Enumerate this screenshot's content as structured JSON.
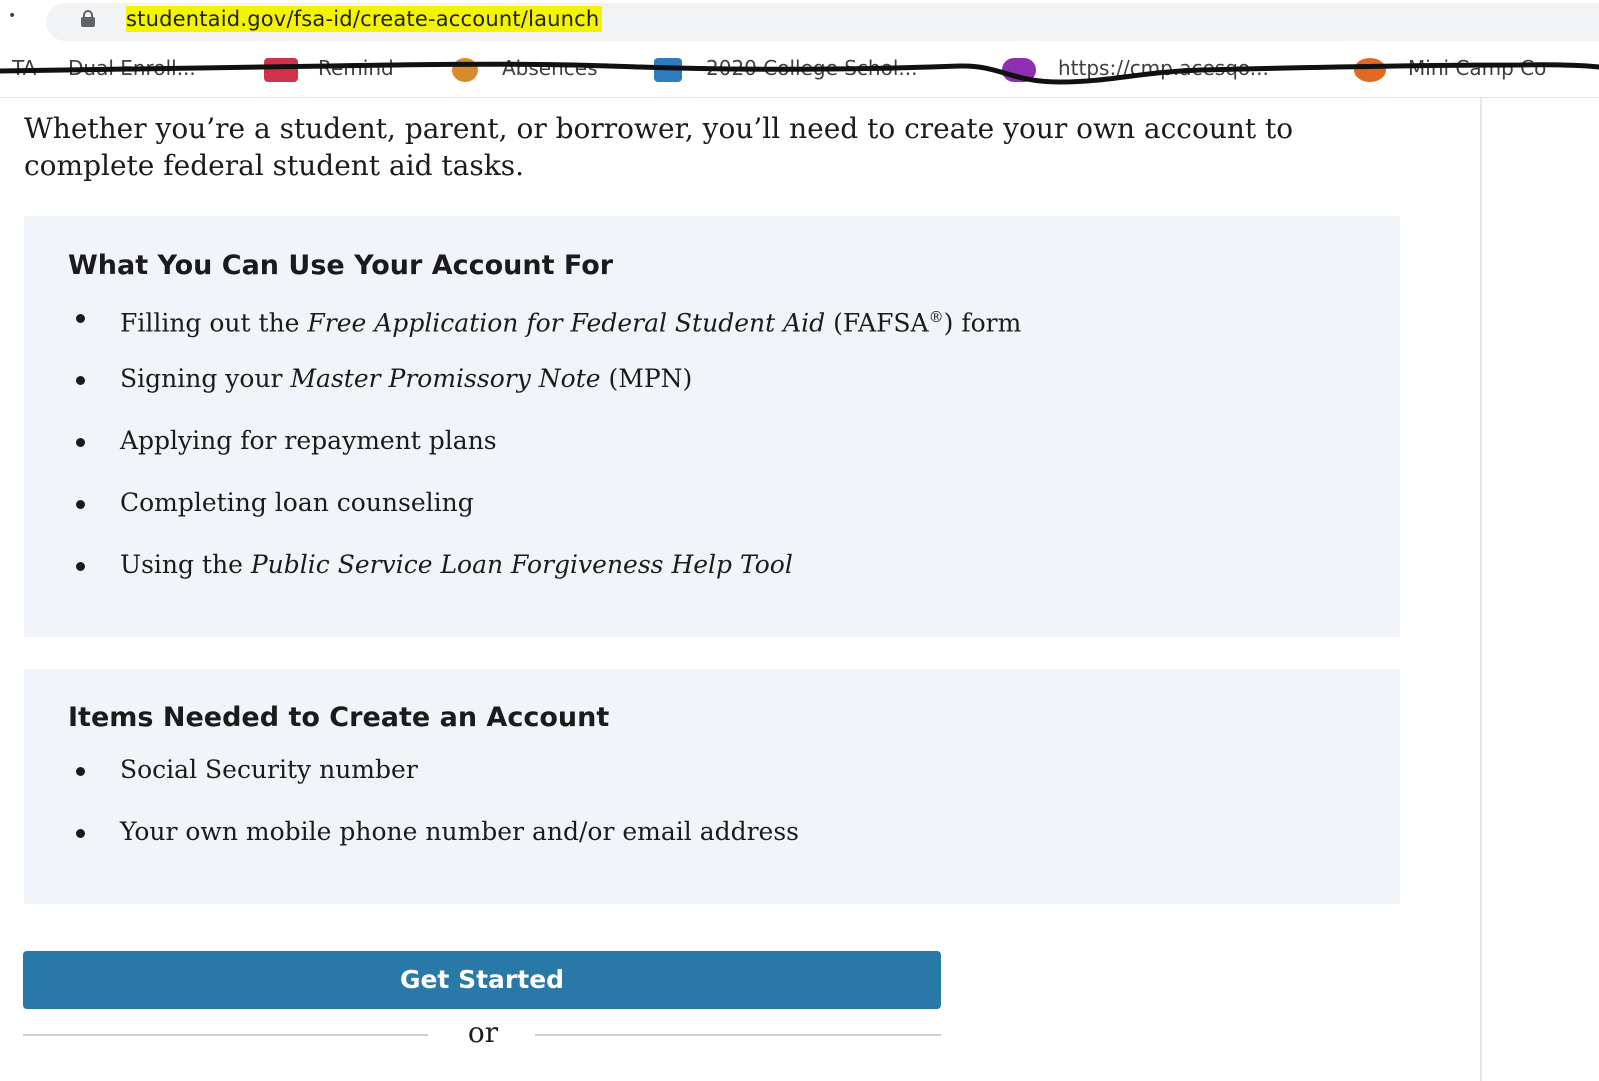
{
  "browser": {
    "url_highlight": "studentaid",
    "url_rest": ".gov/fsa-id/create-account/launch"
  },
  "bookmarks": [
    {
      "label": "TA"
    },
    {
      "label": "Dual Enroll..."
    },
    {
      "label": "Remind"
    },
    {
      "label": "Absences"
    },
    {
      "label": "2020 College Schol..."
    },
    {
      "label": "https://cmp.acesqo..."
    },
    {
      "label": "Mini Camp Co"
    }
  ],
  "intro": {
    "text": "Whether you’re a student, parent, or borrower, you’ll need to create your own account to complete federal student aid tasks."
  },
  "uses_section": {
    "title": "What You Can Use Your Account For",
    "item1_pre": "Filling out the ",
    "item1_em": "Free Application for Federal Student Aid",
    "item1_mid": " (FAFSA",
    "item1_sup": "®",
    "item1_post": ") form",
    "item2_pre": "Signing your ",
    "item2_em": "Master Promissory Note",
    "item2_post": " (MPN)",
    "item3": "Applying for repayment plans",
    "item4": "Completing loan counseling",
    "item5_pre": "Using the ",
    "item5_em": "Public Service Loan Forgiveness Help Tool"
  },
  "items_section": {
    "title": "Items Needed to Create an Account",
    "item1": "Social Security number",
    "item2": "Your own mobile phone number and/or email address"
  },
  "actions": {
    "get_started": "Get Started",
    "or": "or"
  },
  "colors": {
    "url_highlight": "#f4f400",
    "panel_bg": "#f1f4f8",
    "button": "#2878a8"
  }
}
